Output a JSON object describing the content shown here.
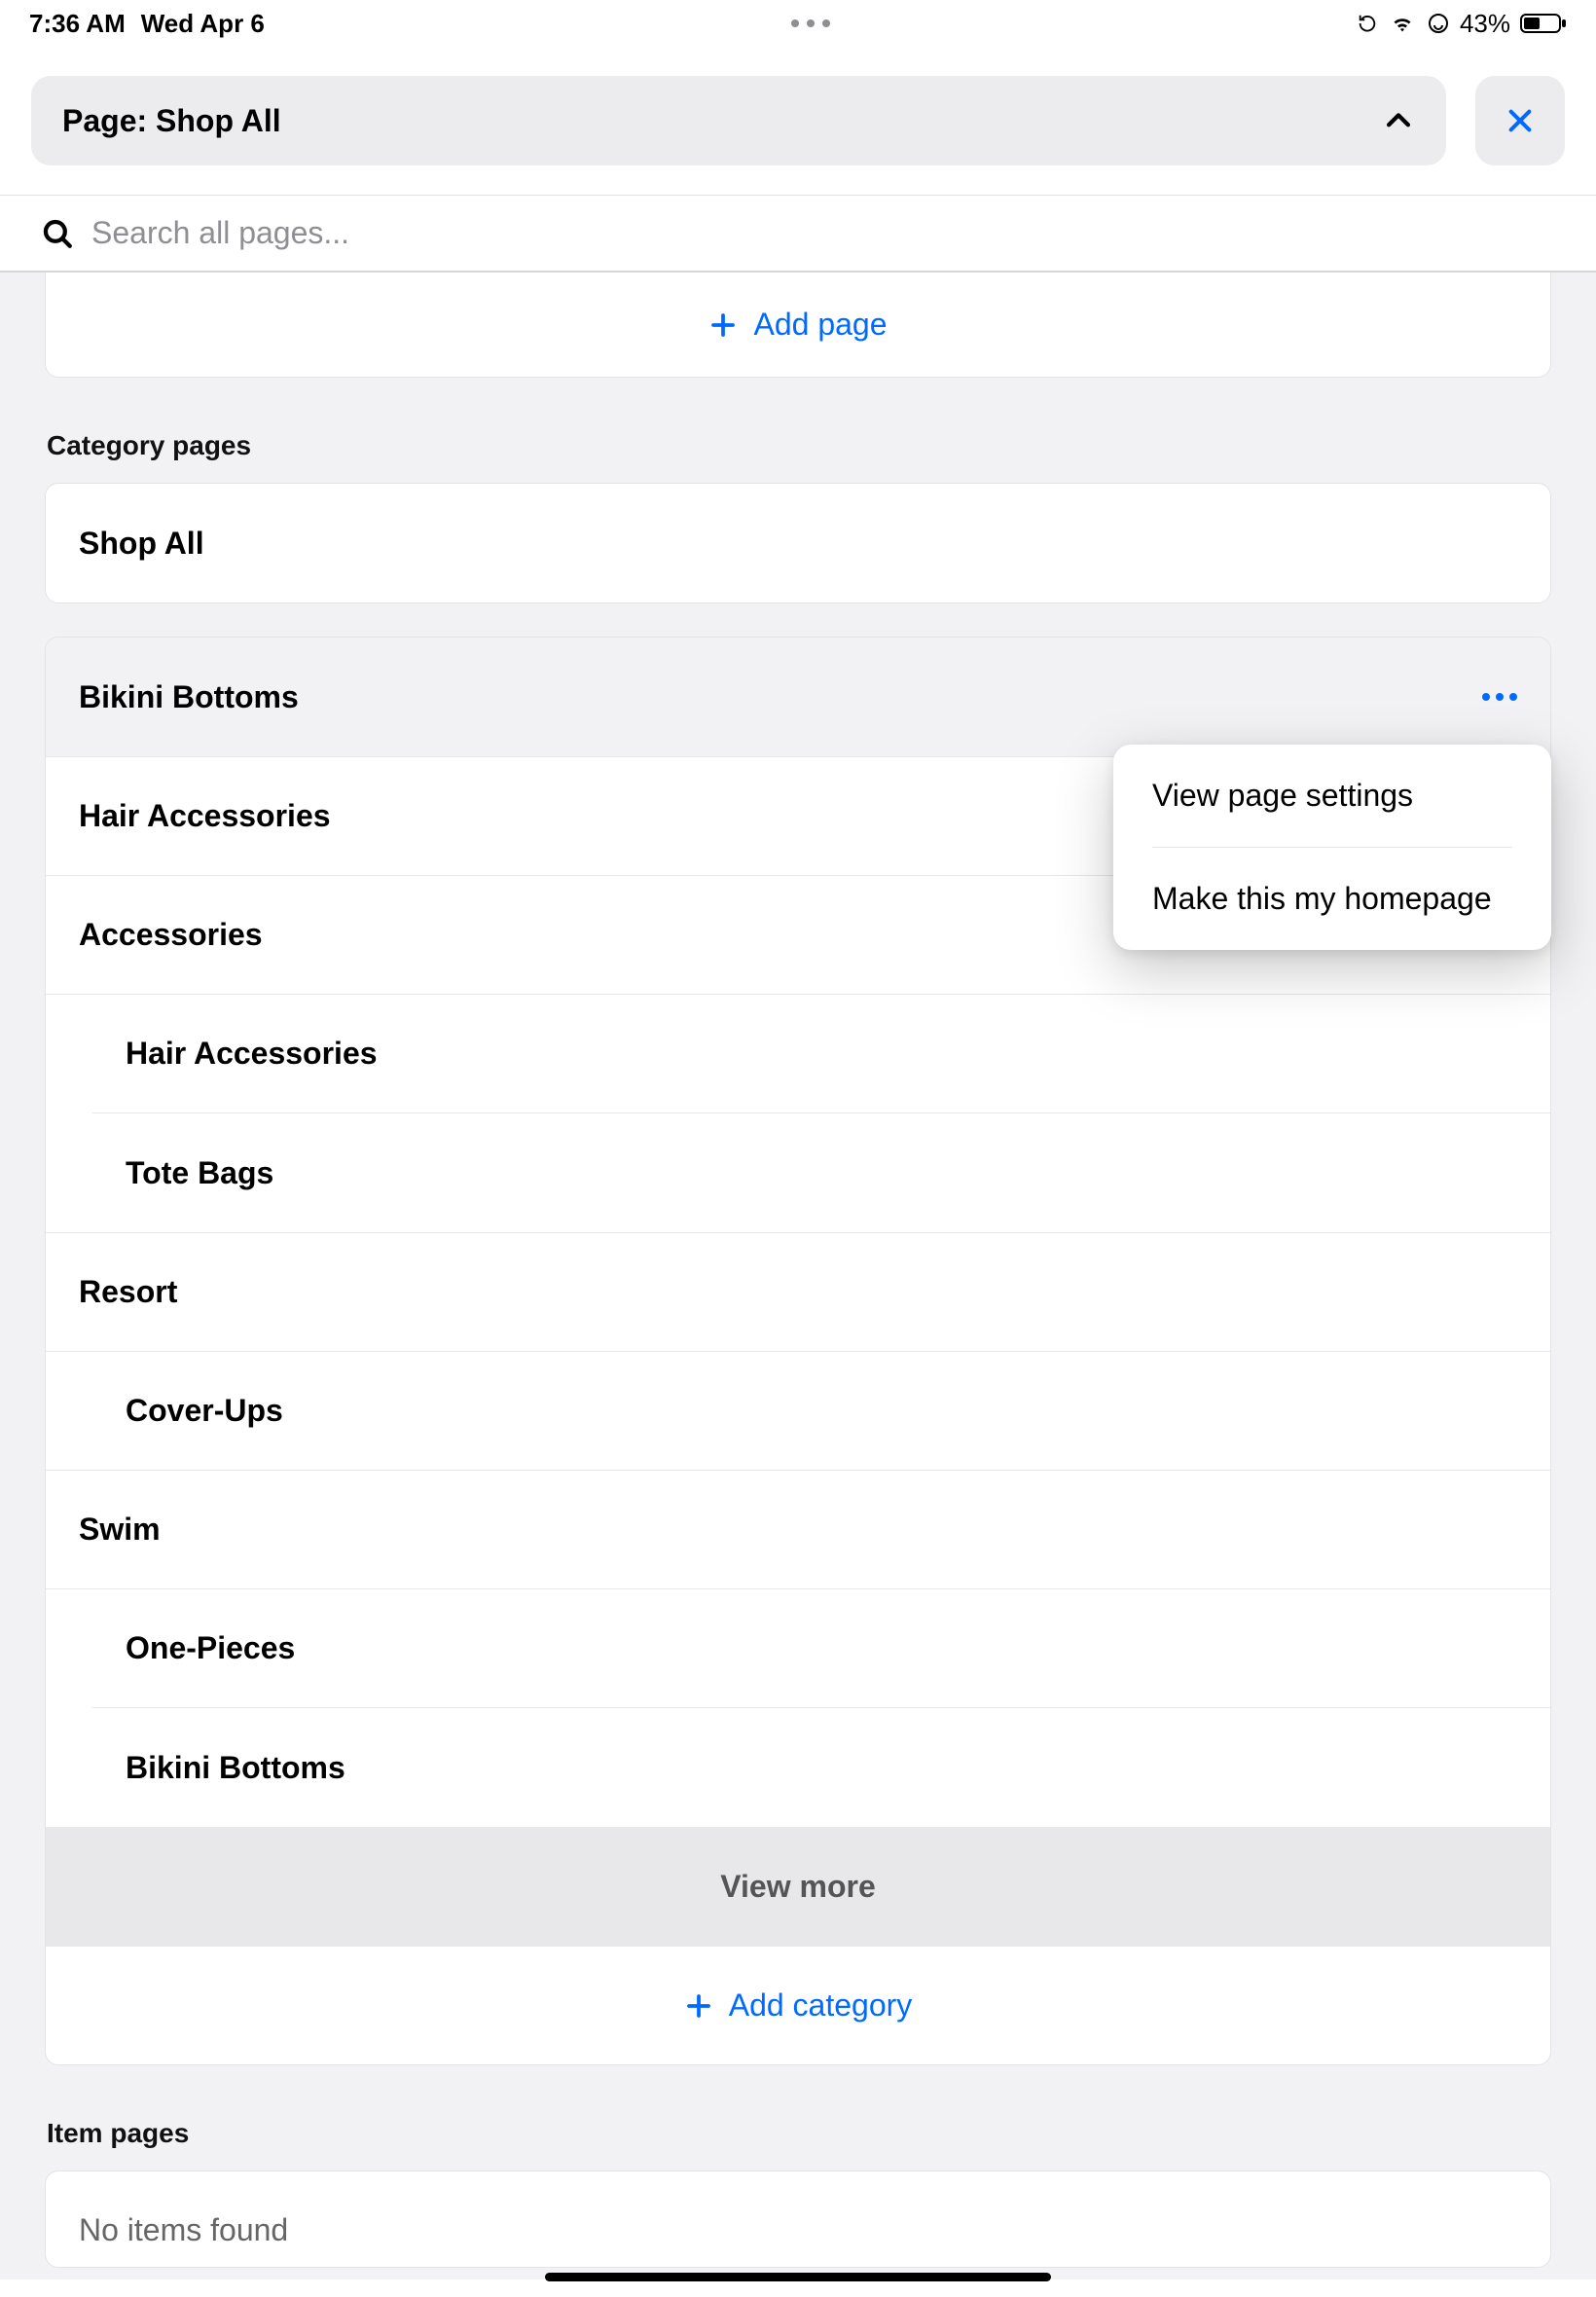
{
  "status": {
    "time": "7:36 AM",
    "date": "Wed Apr 6",
    "battery_pct": "43%"
  },
  "header": {
    "page_label": "Page: Shop All"
  },
  "search": {
    "placeholder": "Search all pages..."
  },
  "add_page_label": "Add page",
  "sections": {
    "category_title": "Category pages",
    "item_title": "Item pages"
  },
  "shop_all_label": "Shop All",
  "categories": [
    {
      "label": "Bikini Bottoms",
      "selected": true
    },
    {
      "label": "Hair Accessories"
    },
    {
      "label": "Accessories",
      "children": [
        "Hair Accessories",
        "Tote Bags"
      ]
    },
    {
      "label": "Resort",
      "children": [
        "Cover-Ups"
      ]
    },
    {
      "label": "Swim",
      "children": [
        "One-Pieces",
        "Bikini Bottoms"
      ]
    }
  ],
  "view_more": "View more",
  "add_category_label": "Add category",
  "popover": {
    "view_settings": "View page settings",
    "make_homepage": "Make this my homepage"
  },
  "items_empty": "No items found"
}
